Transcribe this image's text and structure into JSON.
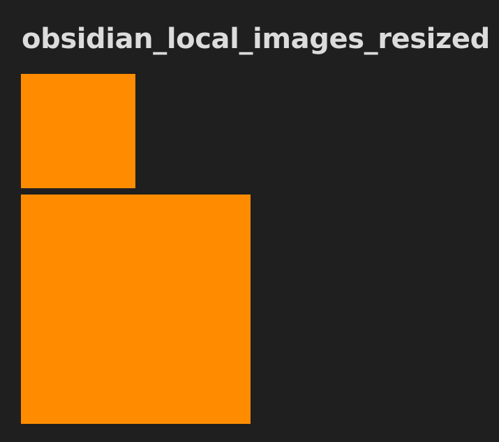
{
  "document": {
    "title": "obsidian_local_images_resized"
  },
  "colors": {
    "background": "#1f1f1f",
    "text": "#dcdcdc",
    "image_fill": "#ff8c00"
  },
  "images": [
    {
      "name": "small-image"
    },
    {
      "name": "large-image"
    }
  ]
}
